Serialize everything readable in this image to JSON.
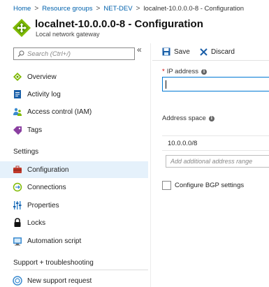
{
  "breadcrumb": {
    "items": [
      "Home",
      "Resource groups",
      "NET-DEV"
    ],
    "separator": ">",
    "current": "localnet-10.0.0.0-8 - Configuration"
  },
  "header": {
    "title": "localnet-10.0.0.0-8 - Configuration",
    "subtitle": "Local network gateway",
    "icon": "local-network-gateway-icon"
  },
  "sidebar": {
    "search_placeholder": "Search (Ctrl+/)",
    "collapse_glyph": "«",
    "top_items": [
      {
        "label": "Overview",
        "icon": "overview-icon"
      },
      {
        "label": "Activity log",
        "icon": "activity-log-icon"
      },
      {
        "label": "Access control (IAM)",
        "icon": "access-control-icon"
      },
      {
        "label": "Tags",
        "icon": "tag-icon"
      }
    ],
    "settings_heading": "Settings",
    "settings_items": [
      {
        "label": "Configuration",
        "icon": "toolbox-icon",
        "selected": true
      },
      {
        "label": "Connections",
        "icon": "connections-icon"
      },
      {
        "label": "Properties",
        "icon": "properties-icon"
      },
      {
        "label": "Locks",
        "icon": "lock-icon"
      },
      {
        "label": "Automation script",
        "icon": "automation-script-icon"
      }
    ],
    "support_heading": "Support + troubleshooting",
    "support_items": [
      {
        "label": "New support request",
        "icon": "support-request-icon"
      }
    ]
  },
  "toolbar": {
    "save_label": "Save",
    "discard_label": "Discard"
  },
  "form": {
    "ip_address": {
      "label": "IP address",
      "required_marker": "*",
      "value": ""
    },
    "address_space": {
      "label": "Address space",
      "entries": [
        "10.0.0.0/8"
      ],
      "add_placeholder": "Add additional address range"
    },
    "bgp": {
      "label": "Configure BGP settings",
      "checked": false
    }
  },
  "colors": {
    "accent": "#0078d4",
    "link": "#0062ad",
    "selected_bg": "#e5f1fb",
    "required": "#d00000"
  }
}
